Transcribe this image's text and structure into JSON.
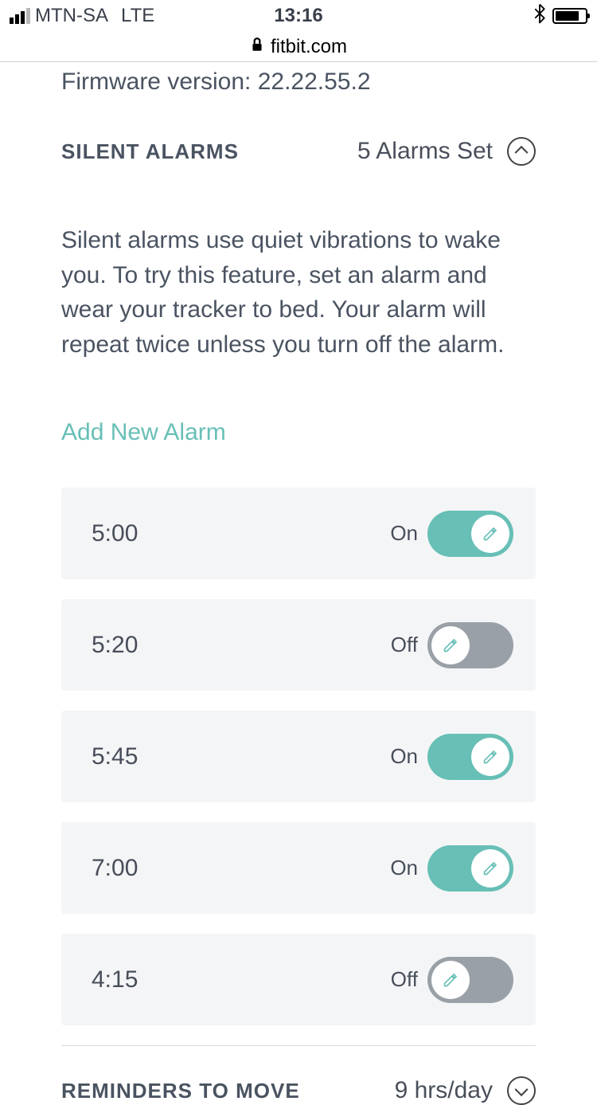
{
  "status_bar": {
    "carrier": "MTN-SA",
    "network": "LTE",
    "time": "13:16"
  },
  "url_bar": {
    "domain": "fitbit.com"
  },
  "firmware_label": "Firmware version: 22.22.55.2",
  "alarms_section": {
    "title": "SILENT ALARMS",
    "summary": "5 Alarms Set",
    "description": "Silent alarms use quiet vibrations to wake you. To try this feature, set an alarm and wear your tracker to bed. Your alarm will repeat twice unless you turn off the alarm.",
    "add_label": "Add New Alarm",
    "state_on": "On",
    "state_off": "Off",
    "alarms": [
      {
        "time": "5:00",
        "on": true
      },
      {
        "time": "5:20",
        "on": false
      },
      {
        "time": "5:45",
        "on": true
      },
      {
        "time": "7:00",
        "on": true
      },
      {
        "time": "4:15",
        "on": false
      }
    ]
  },
  "reminders_section": {
    "title": "REMINDERS TO MOVE",
    "summary": "9 hrs/day"
  },
  "colors": {
    "accent": "#67bfb6",
    "grey_toggle": "#9aa0a7",
    "row_bg": "#f4f5f6",
    "text": "#4a5361"
  }
}
